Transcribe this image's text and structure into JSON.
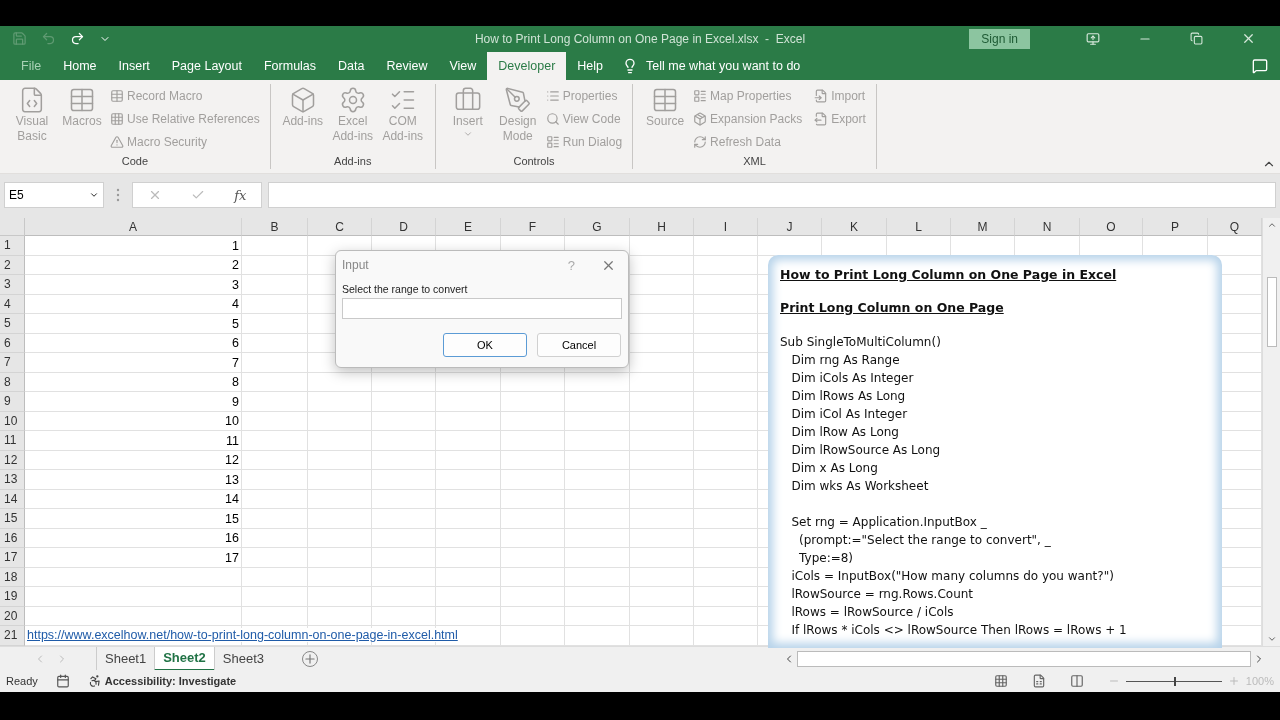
{
  "title_bar": {
    "title": "How to Print Long Column on One Page in Excel.xlsx  -  Excel",
    "sign_in": "Sign in"
  },
  "ribbon_tabs": [
    {
      "label": "File",
      "selected": false,
      "disabled": true
    },
    {
      "label": "Home",
      "selected": false,
      "disabled": false
    },
    {
      "label": "Insert",
      "selected": false,
      "disabled": false
    },
    {
      "label": "Page Layout",
      "selected": false,
      "disabled": false
    },
    {
      "label": "Formulas",
      "selected": false,
      "disabled": false
    },
    {
      "label": "Data",
      "selected": false,
      "disabled": false
    },
    {
      "label": "Review",
      "selected": false,
      "disabled": false
    },
    {
      "label": "View",
      "selected": false,
      "disabled": false
    },
    {
      "label": "Developer",
      "selected": true,
      "disabled": false
    },
    {
      "label": "Help",
      "selected": false,
      "disabled": false
    }
  ],
  "tell_me": "Tell me what you want to do",
  "ribbon_groups": [
    {
      "label": "Code",
      "large": [
        {
          "label": "Visual Basic"
        },
        {
          "label": "Macros"
        }
      ],
      "small": [
        {
          "label": "Record Macro"
        },
        {
          "label": "Use Relative References"
        },
        {
          "label": "Macro Security"
        }
      ]
    },
    {
      "label": "Add-ins",
      "large": [
        {
          "label": "Add-ins"
        },
        {
          "label": "Excel Add-ins"
        },
        {
          "label": "COM Add-ins"
        }
      ]
    },
    {
      "label": "Controls",
      "large": [
        {
          "label": "Insert"
        },
        {
          "label": "Design Mode"
        }
      ],
      "small": [
        {
          "label": "Properties"
        },
        {
          "label": "View Code"
        },
        {
          "label": "Run Dialog"
        }
      ]
    },
    {
      "label": "XML",
      "large": [
        {
          "label": "Source"
        }
      ],
      "small": [
        {
          "label": "Map Properties"
        },
        {
          "label": "Expansion Packs"
        },
        {
          "label": "Refresh Data"
        },
        {
          "label": "Import"
        },
        {
          "label": "Export"
        }
      ]
    }
  ],
  "formula_bar": {
    "name_box": "E5",
    "fx": "fx"
  },
  "columns": [
    "A",
    "B",
    "C",
    "D",
    "E",
    "F",
    "G",
    "H",
    "I",
    "J",
    "K",
    "L",
    "M",
    "N",
    "O",
    "P",
    "Q"
  ],
  "rows": [
    {
      "number": "1",
      "a": "1"
    },
    {
      "number": "2",
      "a": "2"
    },
    {
      "number": "3",
      "a": "3"
    },
    {
      "number": "4",
      "a": "4"
    },
    {
      "number": "5",
      "a": "5"
    },
    {
      "number": "6",
      "a": "6"
    },
    {
      "number": "7",
      "a": "7"
    },
    {
      "number": "8",
      "a": "8"
    },
    {
      "number": "9",
      "a": "9"
    },
    {
      "number": "10",
      "a": "10"
    },
    {
      "number": "11",
      "a": "11"
    },
    {
      "number": "12",
      "a": "12"
    },
    {
      "number": "13",
      "a": "13"
    },
    {
      "number": "14",
      "a": "14"
    },
    {
      "number": "15",
      "a": "15"
    },
    {
      "number": "16",
      "a": "16"
    },
    {
      "number": "17",
      "a": "17"
    },
    {
      "number": "18"
    },
    {
      "number": "19"
    },
    {
      "number": "20"
    },
    {
      "number": "21",
      "link": "https://www.excelhow.net/how-to-print-long-column-on-one-page-in-excel.html"
    }
  ],
  "text_box": {
    "title": "How to Print Long Column on One Page in Excel",
    "subtitle": "Print Long Column on One Page",
    "code_blocks": [
      [
        "Sub SingleToMultiColumn()",
        "   Dim rng As Range",
        "   Dim iCols As Integer",
        "   Dim lRows As Long",
        "   Dim iCol As Integer",
        "   Dim lRow As Long",
        "   Dim lRowSource As Long",
        "   Dim x As Long",
        "   Dim wks As Worksheet"
      ],
      [
        "   Set rng = Application.InputBox _",
        "     (prompt:=\"Select the range to convert\", _",
        "     Type:=8)",
        "   iCols = InputBox(\"How many columns do you want?\")",
        "   lRowSource = rng.Rows.Count",
        "   lRows = lRowSource / iCols",
        "   If lRows * iCols <> lRowSource Then lRows = lRows + 1"
      ]
    ]
  },
  "dialog": {
    "title": "Input",
    "help": "?",
    "prompt": "Select the range to convert",
    "buttons": [
      {
        "label": "OK",
        "default": true
      },
      {
        "label": "Cancel",
        "default": false
      }
    ]
  },
  "sheet_tabs": [
    {
      "label": "Sheet1",
      "selected": false
    },
    {
      "label": "Sheet2",
      "selected": true
    },
    {
      "label": "Sheet3",
      "selected": false
    }
  ],
  "status_bar": {
    "ready": "Ready",
    "accessibility": "Accessibility: Investigate",
    "zoom": {
      "level": 0.5,
      "reading": "100%"
    }
  }
}
